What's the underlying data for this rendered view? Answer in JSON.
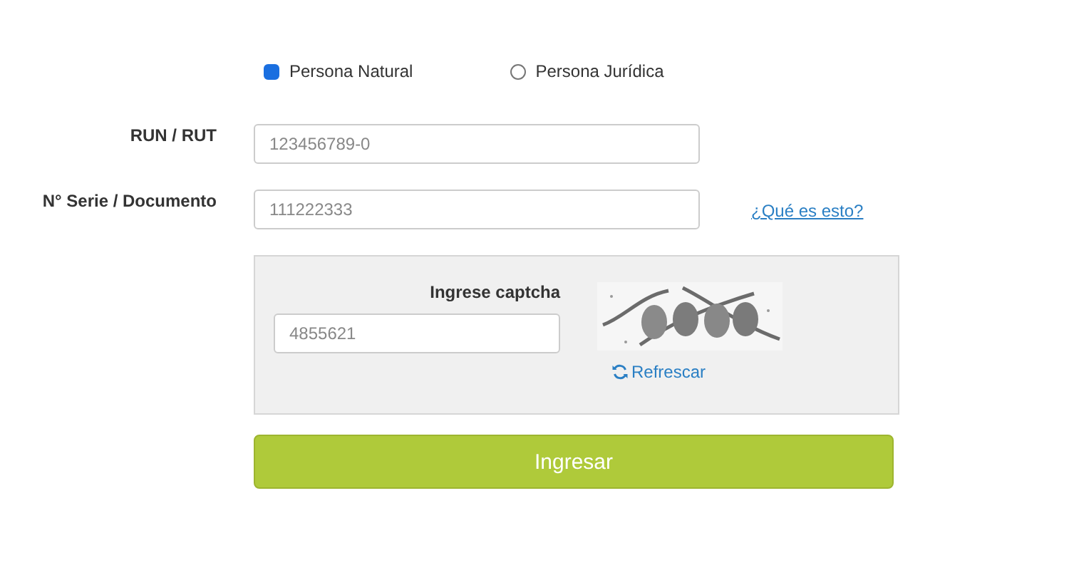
{
  "person_type": [
    {
      "label": "Persona Natural",
      "selected": true
    },
    {
      "label": "Persona Jurídica",
      "selected": false
    }
  ],
  "fields": [
    {
      "label": "RUN / RUT",
      "placeholder": "123456789-0"
    },
    {
      "label": "N° Serie / Documento",
      "placeholder": "111222333",
      "help_link": "¿Qué es esto?"
    }
  ],
  "captcha": {
    "label": "Ingrese captcha",
    "placeholder": "4855621",
    "refresh": "Refrescar"
  },
  "submit": "Ingresar"
}
